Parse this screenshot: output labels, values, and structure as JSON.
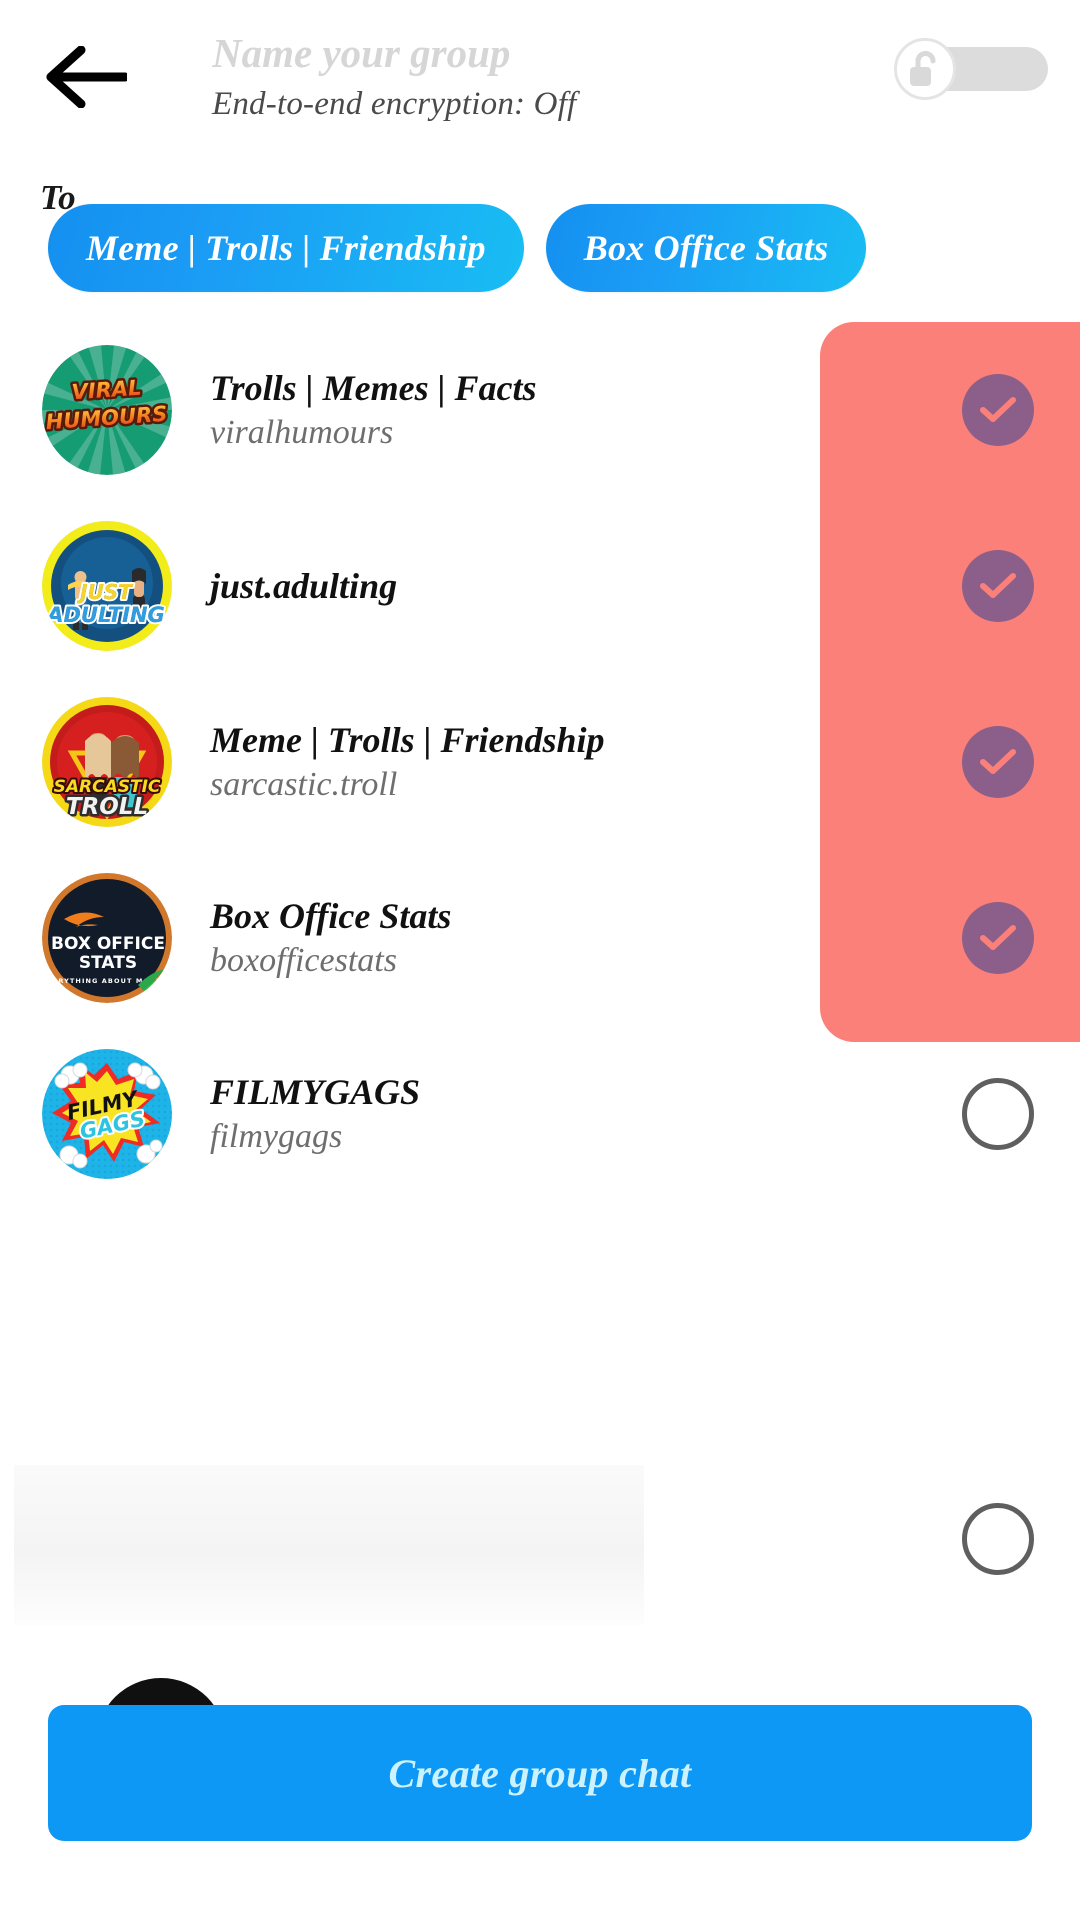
{
  "header": {
    "back_icon": "arrow-left-icon",
    "group_name_value": "",
    "group_name_placeholder": "Name your group",
    "encryption_status": "End-to-end encryption: Off",
    "toggle": {
      "icon": "unlocked-padlock-icon",
      "state": "off"
    }
  },
  "recipients": {
    "label": "To",
    "chips": [
      {
        "label": "Meme | Trolls | Friendship"
      },
      {
        "label": "Box Office Stats"
      }
    ]
  },
  "contacts": [
    {
      "title": "Trolls | Memes | Facts",
      "subtitle": "viralhumours",
      "avatar": "viral-humours-logo",
      "selected": true
    },
    {
      "title": "just.adulting",
      "subtitle": "",
      "avatar": "just-adulting-logo",
      "selected": true
    },
    {
      "title": "Meme | Trolls | Friendship",
      "subtitle": "sarcastic.troll",
      "avatar": "sarcastic-troll-logo",
      "selected": true
    },
    {
      "title": "Box Office Stats",
      "subtitle": "boxofficestats",
      "avatar": "box-office-stats-logo",
      "selected": true
    },
    {
      "title": "FILMYGAGS",
      "subtitle": "filmygags",
      "avatar": "filmy-gags-logo",
      "selected": false
    }
  ],
  "avatar_text": {
    "viral_humours_line1": "VIRAL",
    "viral_humours_line2": "HUMOURS",
    "just_adulting_line1": "JUST",
    "just_adulting_line2": "ADULTING",
    "sarcastic_troll_line1": "SARCASTIC",
    "sarcastic_troll_line2": "TROLL",
    "box_office_line1": "BOX OFFICE",
    "box_office_line2": "STATS",
    "box_office_tagline": "EVERYTHING ABOUT MOVIES",
    "filmy_gags_line1": "FILMY",
    "filmy_gags_line2": "GAGS"
  },
  "cta": {
    "label": "Create group chat"
  },
  "colors": {
    "accent_blue": "#0e98f5",
    "chip_gradient_start": "#1490f0",
    "chip_gradient_end": "#19bdf3",
    "selection_panel": "#fb8079",
    "check_circle": "#8b5f8a",
    "check_mark": "#fb8079",
    "unchecked_border": "#5f5f5f",
    "cta_text": "#ccf2ff",
    "placeholder_text": "#d6d6d6",
    "subtitle_text": "#6e6e6e"
  }
}
